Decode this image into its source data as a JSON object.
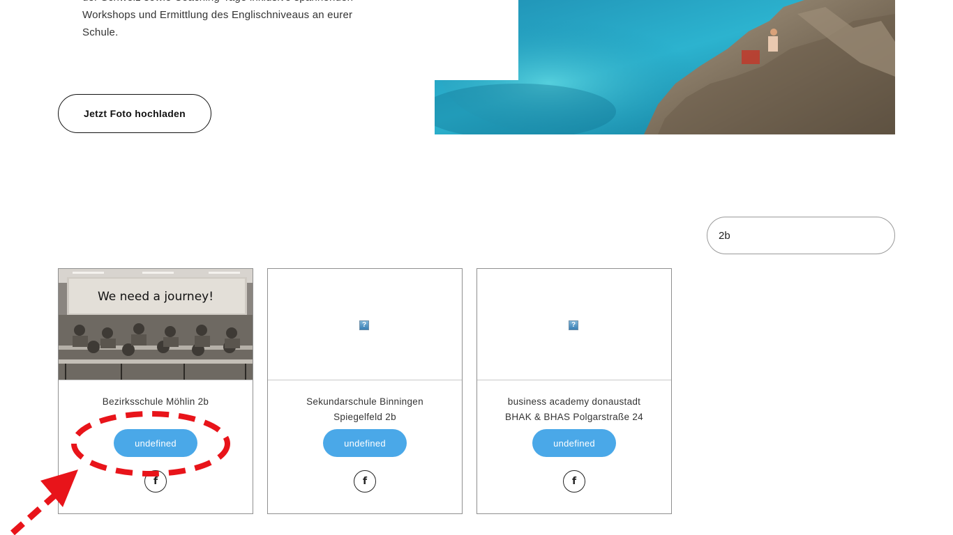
{
  "intro": {
    "line1": "der Schweiz sowie Coaching-Tage inklusive spannenden",
    "line2": "Workshops und Ermittlung des Englischniveaus an eurer",
    "line3": "Schule."
  },
  "upload_button": "Jetzt Foto hochladen",
  "search": {
    "value": "2b"
  },
  "cards": [
    {
      "title_lines": [
        "Bezirksschule Möhlin 2b"
      ],
      "image_caption": "We need a journey!",
      "button_label": "undefined",
      "share_icon": "f"
    },
    {
      "title_lines": [
        "Sekundarschule Binningen",
        "Spiegelfeld 2b"
      ],
      "button_label": "undefined",
      "broken_image_glyph": "?",
      "share_icon": "f"
    },
    {
      "title_lines": [
        "business academy donaustadt",
        "BHAK & BHAS Polgarstraße 24"
      ],
      "button_label": "undefined",
      "broken_image_glyph": "?",
      "share_icon": "f"
    }
  ],
  "colors": {
    "accent_button": "#4aa8e8",
    "annotation_red": "#e8141a"
  },
  "icons": {
    "share": "facebook-icon",
    "broken_image": "broken-image-icon"
  }
}
